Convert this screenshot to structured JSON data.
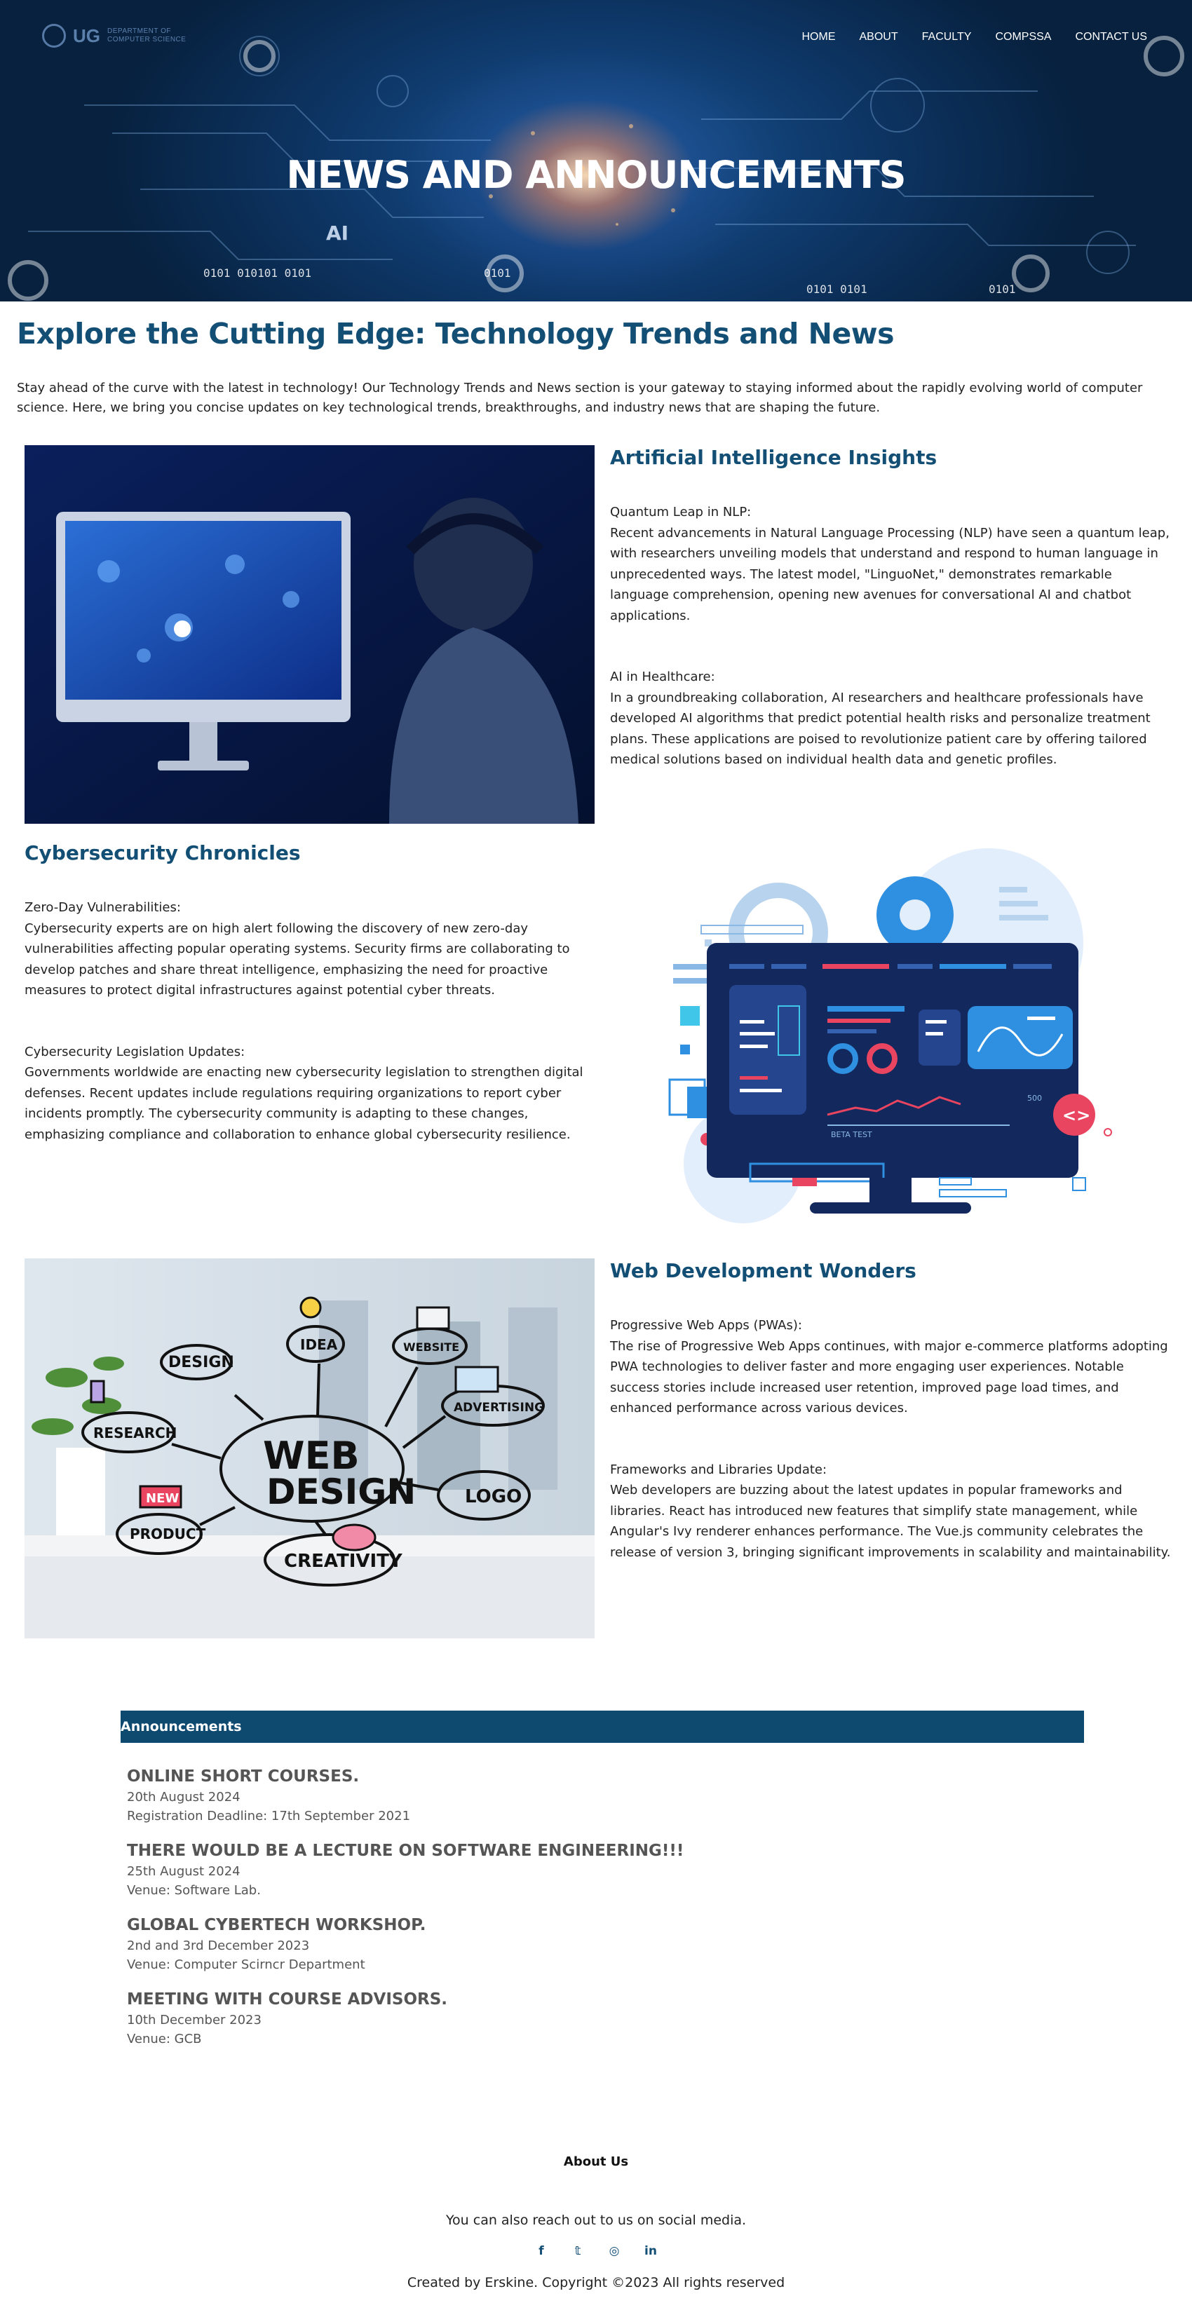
{
  "logo": {
    "abbr": "UG",
    "line1": "DEPARTMENT OF",
    "line2": "COMPUTER SCIENCE"
  },
  "nav": [
    "HOME",
    "ABOUT",
    "FACULTY",
    "COMPSSA",
    "CONTACT US"
  ],
  "hero": {
    "title": "NEWS AND ANNOUNCEMENTS",
    "ai_label": "AI",
    "binary": [
      "0101 010101 0101",
      "0101",
      "0101 0101",
      "0101"
    ]
  },
  "intro": {
    "title": "Explore the Cutting Edge: Technology Trends and News",
    "text": "Stay ahead of the curve with the latest in technology! Our Technology Trends and News section is your gateway to staying informed about the rapidly evolving world of computer science. Here, we bring you concise updates on key technological trends, breakthroughs, and industry news that are shaping the future."
  },
  "sections": {
    "ai": {
      "title": "Artificial Intelligence Insights",
      "p1_head": "Quantum Leap in NLP:",
      "p1_body": "Recent advancements in Natural Language Processing (NLP) have seen a quantum leap, with researchers unveiling models that understand and respond to human language in unprecedented ways. The latest model, \"LinguoNet,\" demonstrates remarkable language comprehension, opening new avenues for conversational AI and chatbot applications.",
      "p2_head": "AI in Healthcare:",
      "p2_body": "In a groundbreaking collaboration, AI researchers and healthcare professionals have developed AI algorithms that predict potential health risks and personalize treatment plans. These applications are poised to revolutionize patient care by offering tailored medical solutions based on individual health data and genetic profiles."
    },
    "cyber": {
      "title": "Cybersecurity Chronicles",
      "p1_head": "Zero-Day Vulnerabilities:",
      "p1_body": "Cybersecurity experts are on high alert following the discovery of new zero-day vulnerabilities affecting popular operating systems. Security firms are collaborating to develop patches and share threat intelligence, emphasizing the need for proactive measures to protect digital infrastructures against potential cyber threats.",
      "p2_head": "Cybersecurity Legislation Updates:",
      "p2_body": "Governments worldwide are enacting new cybersecurity legislation to strengthen digital defenses. Recent updates include regulations requiring organizations to report cyber incidents promptly. The cybersecurity community is adapting to these changes, emphasizing compliance and collaboration to enhance global cybersecurity resilience.",
      "illustration_tag": "BETA TEST",
      "illustration_value": "500"
    },
    "web": {
      "title": "Web Development Wonders",
      "p1_head": "Progressive Web Apps (PWAs):",
      "p1_body": "The rise of Progressive Web Apps continues, with major e-commerce platforms adopting PWA technologies to deliver faster and more engaging user experiences. Notable success stories include increased user retention, improved page load times, and enhanced performance across various devices.",
      "p2_head": "Frameworks and Libraries Update:",
      "p2_body": "Web developers are buzzing about the latest updates in popular frameworks and libraries. React has introduced new features that simplify state management, while Angular's Ivy renderer enhances performance. The Vue.js community celebrates the release of version 3, bringing significant improvements in scalability and maintainability.",
      "doodles": [
        "WEB",
        "DESIGN",
        "IDEA",
        "WEBSITE",
        "DESIGN",
        "RESEARCH",
        "ADVERTISING",
        "LOGO",
        "NEW",
        "PRODUCT",
        "CREATIVITY"
      ]
    }
  },
  "announcements": {
    "header": "Announcements",
    "items": [
      {
        "title": "ONLINE SHORT COURSES.",
        "line1": "20th August 2024",
        "line2": "Registration Deadline: 17th September 2021"
      },
      {
        "title": "THERE WOULD BE A LECTURE ON SOFTWARE ENGINEERING!!!",
        "line1": "25th August 2024",
        "line2": "Venue: Software Lab."
      },
      {
        "title": "GLOBAL CYBERTECH WORKSHOP.",
        "line1": "2nd and 3rd December 2023",
        "line2": "Venue: Computer Scirncr Department"
      },
      {
        "title": "MEETING WITH COURSE ADVISORS.",
        "line1": "10th December 2023",
        "line2": "Venue: GCB"
      }
    ]
  },
  "footer": {
    "about": "About Us",
    "reach": "You can also reach out to us on social media.",
    "socials": [
      {
        "icon": "facebook-icon",
        "glyph": "f"
      },
      {
        "icon": "twitter-icon",
        "glyph": "𝕥"
      },
      {
        "icon": "instagram-icon",
        "glyph": "◎"
      },
      {
        "icon": "linkedin-icon",
        "glyph": "in"
      }
    ],
    "copyright": "Created by Erskine. Copyright ©2023 All rights reserved"
  },
  "colors": {
    "brand": "#134e74",
    "bar": "#0e4a6f",
    "hero": "#0f3b6e"
  }
}
